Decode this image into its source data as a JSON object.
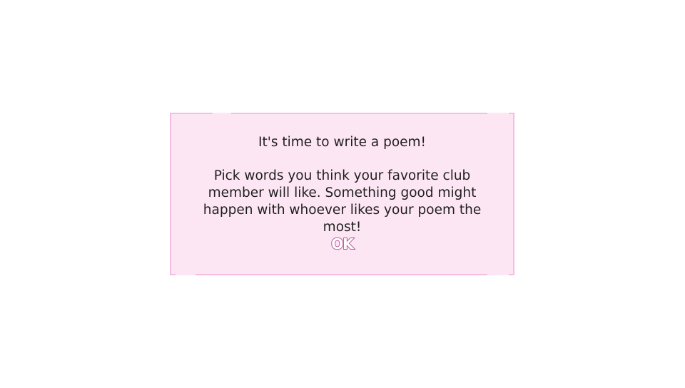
{
  "dialog": {
    "title": "It's time to write a poem!",
    "body": "Pick words you think your favorite club member will like. Something good might happen with whoever likes your poem the most!",
    "ok_label": "OK"
  },
  "colors": {
    "dialog_background": "#fde6f3",
    "dialog_border": "#f5bde0",
    "button_outline": "#b95c9f",
    "text": "#1f1f1f"
  }
}
